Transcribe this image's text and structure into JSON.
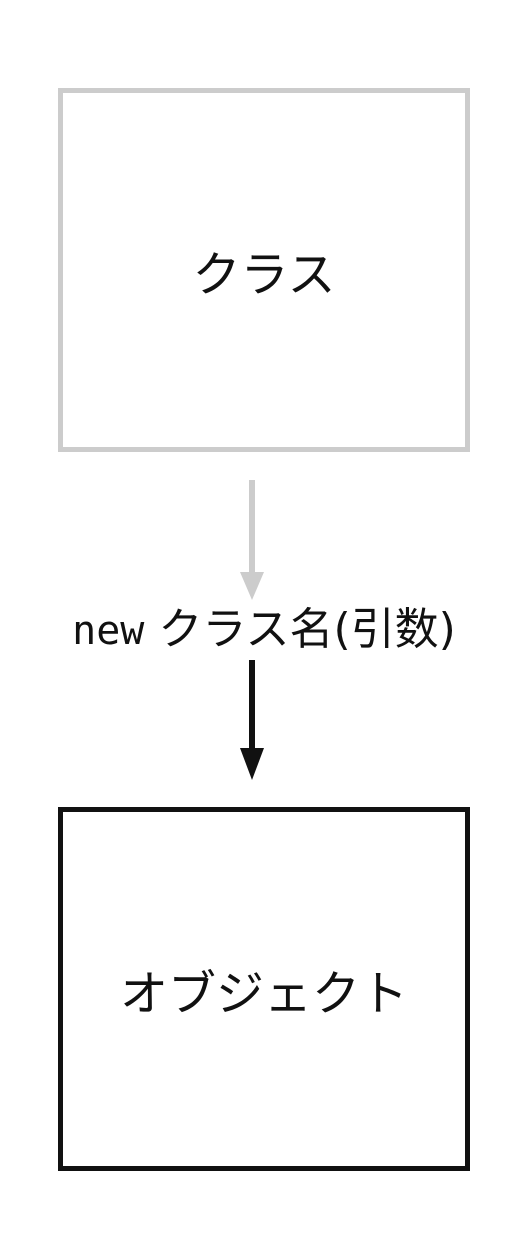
{
  "class_box": {
    "label": "クラス"
  },
  "constructor_call": {
    "keyword": "new",
    "expression": "クラス名(引数)"
  },
  "object_box": {
    "label": "オブジェクト"
  },
  "colors": {
    "class_border": "#cccccc",
    "object_border": "#111111",
    "gray_arrow": "#cccccc",
    "black_arrow": "#111111",
    "text": "#111111"
  }
}
